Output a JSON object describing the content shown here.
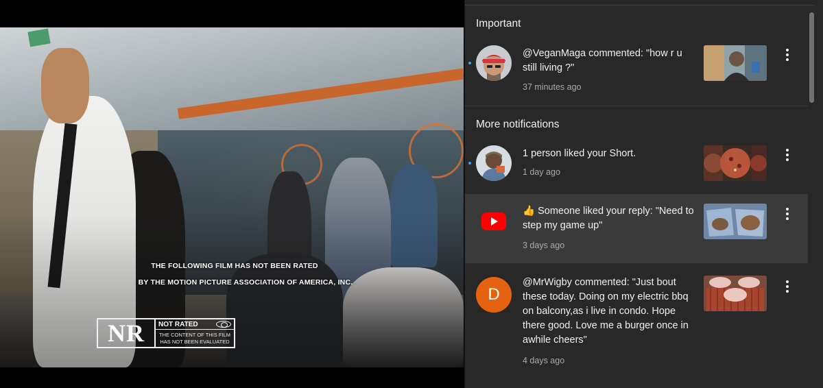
{
  "video": {
    "rating_line_1": "THE FOLLOWING FILM HAS NOT BEEN RATED",
    "rating_line_2": "BY THE MOTION PICTURE ASSOCIATION OF AMERICA, INC.",
    "rating_letters": "NR",
    "rating_title": "NOT RATED",
    "rating_desc_1": "THE CONTENT OF THIS FILM",
    "rating_desc_2": "HAS NOT BEEN EVALUATED"
  },
  "notifications": {
    "important_title": "Important",
    "more_title": "More notifications",
    "important": [
      {
        "text": "@VeganMaga commented: \"how r u still living ?\"",
        "time": "37 minutes ago",
        "avatar": "user-avatar-red-cap",
        "unread": true
      }
    ],
    "more": [
      {
        "text": "1 person liked your Short.",
        "time": "1 day ago",
        "avatar": "user-avatar",
        "unread": true
      },
      {
        "text": "👍 Someone liked your reply: \"Need to step my game up\"",
        "time": "3 days ago",
        "avatar": "youtube-logo-icon",
        "unread": false
      },
      {
        "text": "@MrWigby commented: \"Just bout these today. Doing on my electric bbq on balcony,as i live in condo. Hope there good. Love me a burger once in awhile cheers\"",
        "time": "4 days ago",
        "avatar_letter": "D",
        "avatar_color": "#e56310",
        "unread": false
      }
    ]
  },
  "colors": {
    "panel_bg": "#282828",
    "highlight_bg": "#3a3a3a",
    "text_primary": "#f1f1f1",
    "text_secondary": "#aaaaaa",
    "unread_dot": "#3ea6ff",
    "youtube_red": "#ff0000"
  }
}
